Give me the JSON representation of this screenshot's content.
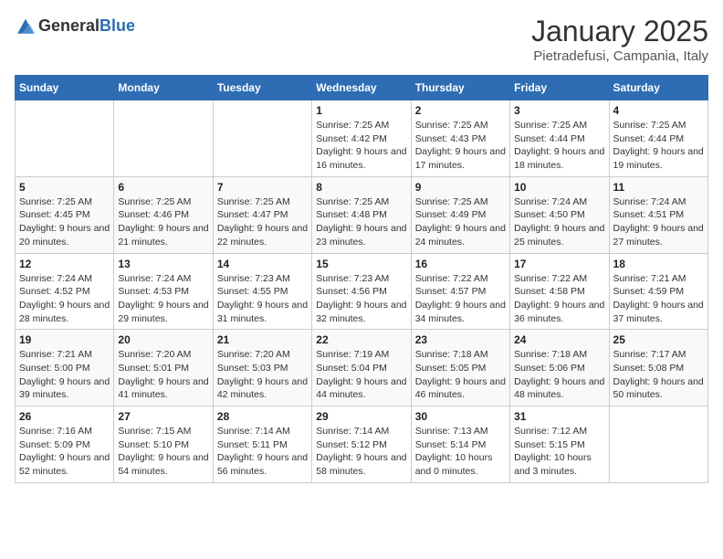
{
  "header": {
    "logo_general": "General",
    "logo_blue": "Blue",
    "month": "January 2025",
    "location": "Pietradefusi, Campania, Italy"
  },
  "days_of_week": [
    "Sunday",
    "Monday",
    "Tuesday",
    "Wednesday",
    "Thursday",
    "Friday",
    "Saturday"
  ],
  "weeks": [
    [
      {
        "day": "",
        "info": ""
      },
      {
        "day": "",
        "info": ""
      },
      {
        "day": "",
        "info": ""
      },
      {
        "day": "1",
        "info": "Sunrise: 7:25 AM\nSunset: 4:42 PM\nDaylight: 9 hours and 16 minutes."
      },
      {
        "day": "2",
        "info": "Sunrise: 7:25 AM\nSunset: 4:43 PM\nDaylight: 9 hours and 17 minutes."
      },
      {
        "day": "3",
        "info": "Sunrise: 7:25 AM\nSunset: 4:44 PM\nDaylight: 9 hours and 18 minutes."
      },
      {
        "day": "4",
        "info": "Sunrise: 7:25 AM\nSunset: 4:44 PM\nDaylight: 9 hours and 19 minutes."
      }
    ],
    [
      {
        "day": "5",
        "info": "Sunrise: 7:25 AM\nSunset: 4:45 PM\nDaylight: 9 hours and 20 minutes."
      },
      {
        "day": "6",
        "info": "Sunrise: 7:25 AM\nSunset: 4:46 PM\nDaylight: 9 hours and 21 minutes."
      },
      {
        "day": "7",
        "info": "Sunrise: 7:25 AM\nSunset: 4:47 PM\nDaylight: 9 hours and 22 minutes."
      },
      {
        "day": "8",
        "info": "Sunrise: 7:25 AM\nSunset: 4:48 PM\nDaylight: 9 hours and 23 minutes."
      },
      {
        "day": "9",
        "info": "Sunrise: 7:25 AM\nSunset: 4:49 PM\nDaylight: 9 hours and 24 minutes."
      },
      {
        "day": "10",
        "info": "Sunrise: 7:24 AM\nSunset: 4:50 PM\nDaylight: 9 hours and 25 minutes."
      },
      {
        "day": "11",
        "info": "Sunrise: 7:24 AM\nSunset: 4:51 PM\nDaylight: 9 hours and 27 minutes."
      }
    ],
    [
      {
        "day": "12",
        "info": "Sunrise: 7:24 AM\nSunset: 4:52 PM\nDaylight: 9 hours and 28 minutes."
      },
      {
        "day": "13",
        "info": "Sunrise: 7:24 AM\nSunset: 4:53 PM\nDaylight: 9 hours and 29 minutes."
      },
      {
        "day": "14",
        "info": "Sunrise: 7:23 AM\nSunset: 4:55 PM\nDaylight: 9 hours and 31 minutes."
      },
      {
        "day": "15",
        "info": "Sunrise: 7:23 AM\nSunset: 4:56 PM\nDaylight: 9 hours and 32 minutes."
      },
      {
        "day": "16",
        "info": "Sunrise: 7:22 AM\nSunset: 4:57 PM\nDaylight: 9 hours and 34 minutes."
      },
      {
        "day": "17",
        "info": "Sunrise: 7:22 AM\nSunset: 4:58 PM\nDaylight: 9 hours and 36 minutes."
      },
      {
        "day": "18",
        "info": "Sunrise: 7:21 AM\nSunset: 4:59 PM\nDaylight: 9 hours and 37 minutes."
      }
    ],
    [
      {
        "day": "19",
        "info": "Sunrise: 7:21 AM\nSunset: 5:00 PM\nDaylight: 9 hours and 39 minutes."
      },
      {
        "day": "20",
        "info": "Sunrise: 7:20 AM\nSunset: 5:01 PM\nDaylight: 9 hours and 41 minutes."
      },
      {
        "day": "21",
        "info": "Sunrise: 7:20 AM\nSunset: 5:03 PM\nDaylight: 9 hours and 42 minutes."
      },
      {
        "day": "22",
        "info": "Sunrise: 7:19 AM\nSunset: 5:04 PM\nDaylight: 9 hours and 44 minutes."
      },
      {
        "day": "23",
        "info": "Sunrise: 7:18 AM\nSunset: 5:05 PM\nDaylight: 9 hours and 46 minutes."
      },
      {
        "day": "24",
        "info": "Sunrise: 7:18 AM\nSunset: 5:06 PM\nDaylight: 9 hours and 48 minutes."
      },
      {
        "day": "25",
        "info": "Sunrise: 7:17 AM\nSunset: 5:08 PM\nDaylight: 9 hours and 50 minutes."
      }
    ],
    [
      {
        "day": "26",
        "info": "Sunrise: 7:16 AM\nSunset: 5:09 PM\nDaylight: 9 hours and 52 minutes."
      },
      {
        "day": "27",
        "info": "Sunrise: 7:15 AM\nSunset: 5:10 PM\nDaylight: 9 hours and 54 minutes."
      },
      {
        "day": "28",
        "info": "Sunrise: 7:14 AM\nSunset: 5:11 PM\nDaylight: 9 hours and 56 minutes."
      },
      {
        "day": "29",
        "info": "Sunrise: 7:14 AM\nSunset: 5:12 PM\nDaylight: 9 hours and 58 minutes."
      },
      {
        "day": "30",
        "info": "Sunrise: 7:13 AM\nSunset: 5:14 PM\nDaylight: 10 hours and 0 minutes."
      },
      {
        "day": "31",
        "info": "Sunrise: 7:12 AM\nSunset: 5:15 PM\nDaylight: 10 hours and 3 minutes."
      },
      {
        "day": "",
        "info": ""
      }
    ]
  ]
}
